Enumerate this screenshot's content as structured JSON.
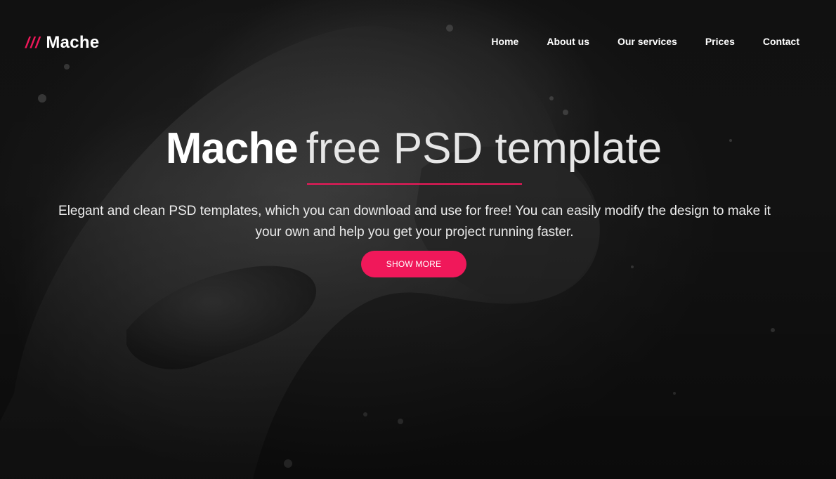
{
  "brand": {
    "mark": "///",
    "name": "Mache"
  },
  "nav": {
    "items": [
      {
        "label": "Home"
      },
      {
        "label": "About us"
      },
      {
        "label": "Our services"
      },
      {
        "label": "Prices"
      },
      {
        "label": "Contact"
      }
    ]
  },
  "hero": {
    "title_strong": "Mache",
    "title_light": "free PSD template",
    "subtitle": "Elegant and clean PSD templates, which you can download and use for free! You can easily modify the design to make it your own and help you get your project running faster.",
    "cta_label": "SHOW MORE"
  },
  "colors": {
    "accent": "#f0185a",
    "background": "#151515",
    "text": "#ffffff"
  }
}
